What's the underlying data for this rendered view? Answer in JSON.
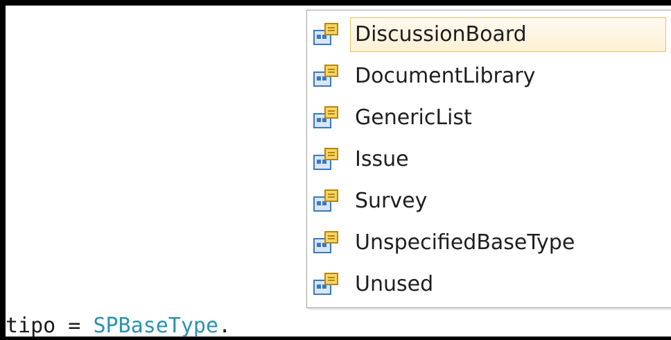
{
  "editor": {
    "code": {
      "variable": "tipo",
      "operator": " = ",
      "type_name": "SPBaseType",
      "dot": "."
    }
  },
  "completion_list": {
    "icon": "enum-member-icon",
    "selected_index": 0,
    "items": [
      {
        "label": "DiscussionBoard"
      },
      {
        "label": "DocumentLibrary"
      },
      {
        "label": "GenericList"
      },
      {
        "label": "Issue"
      },
      {
        "label": "Survey"
      },
      {
        "label": "UnspecifiedBaseType"
      },
      {
        "label": "Unused"
      }
    ]
  },
  "colors": {
    "type_name": "#2b91af",
    "selection_border": "#e5c365",
    "icon_gold": "#e8b51c",
    "icon_blue": "#3a78c5"
  }
}
